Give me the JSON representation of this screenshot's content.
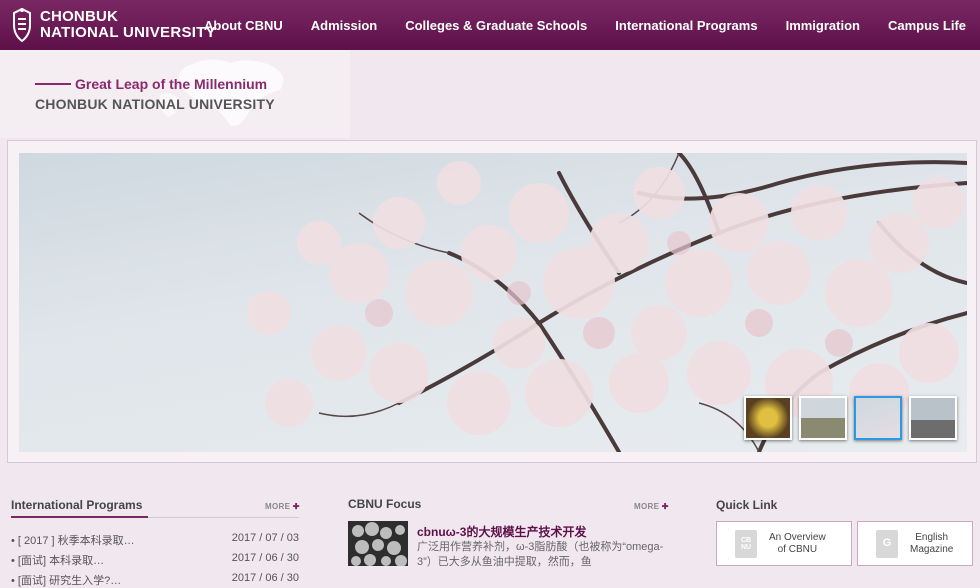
{
  "header": {
    "logo_line1": "CHONBUK",
    "logo_line2": "NATIONAL UNIVERSITY",
    "nav": [
      "About CBNU",
      "Admission",
      "Colleges & Graduate Schools",
      "International Programs",
      "Immigration",
      "Campus Life"
    ],
    "tagline": "Great Leap of the Millennium",
    "university_name": "CHONBUK NATIONAL UNIVERSITY"
  },
  "slider": {
    "thumbnail_count": 4,
    "active_thumbnail": 3
  },
  "international_programs": {
    "title": "International Programs",
    "more": "MORE",
    "items": [
      {
        "title": "• [ 2017 ] 秋季本科录取…",
        "date": "2017 / 07 / 03"
      },
      {
        "title": "• [面试] 本科录取…",
        "date": "2017 / 06 / 30"
      },
      {
        "title": "• [面试] 研究生入学?…",
        "date": "2017 / 06 / 30"
      }
    ]
  },
  "cbnu_focus": {
    "title": "CBNU Focus",
    "more": "MORE",
    "headline": "cbnuω-3的大规模生产技术开发",
    "summary": "广泛用作营养补剂，ω-3脂肪酸（也被称为“omega-3”）已大多从鱼油中提取，然而，鱼"
  },
  "quick_link": {
    "title": "Quick Link",
    "items": [
      {
        "icon": "CB NU",
        "label_line1": "An Overview",
        "label_line2": "of CBNU"
      },
      {
        "icon": "G",
        "label_line1": "English",
        "label_line2": "Magazine"
      }
    ]
  },
  "colors": {
    "brand": "#6a1a55",
    "accent": "#7a2863",
    "active_thumb": "#2a9ae6"
  }
}
